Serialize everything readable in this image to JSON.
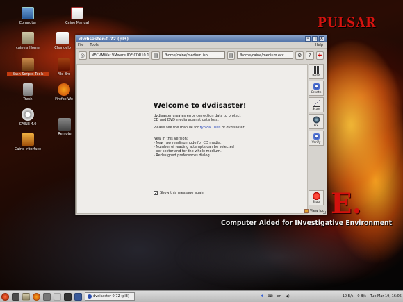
{
  "desktop": {
    "icons": [
      {
        "label": "Computer"
      },
      {
        "label": "Caine Manual"
      },
      {
        "label": "caine's Home"
      },
      {
        "label": "Changelo"
      },
      {
        "label": "Bash Scripts Tools"
      },
      {
        "label": "File Bro"
      },
      {
        "label": "Trash"
      },
      {
        "label": "Firefox We"
      },
      {
        "label": "CAINE 4.0"
      },
      {
        "label": "Remote"
      },
      {
        "label": "Caine Interface"
      }
    ],
    "brand": {
      "title": "PULSAR",
      "letter": "E.",
      "tagline": "Computer Aided for INvestigative Environment"
    },
    "colors": {
      "brand_red": "#d6130f",
      "selection": "#c33b10"
    }
  },
  "window": {
    "title": "dvdisaster-0.72 (pl3)",
    "menu": {
      "file": "File",
      "tools": "Tools",
      "help": "Help"
    },
    "toolbar": {
      "drive": "NECVMWar VMware IDE CDR10 1.0",
      "image_file": "/home/caine/medium.iso",
      "ecc_file": "/home/caine/medium.ecc"
    },
    "welcome": {
      "title": "Welcome to dvdisaster!",
      "para1_line1": "dvdisaster creates error correction data to protect",
      "para1_line2": "CD and DVD media against data loss.",
      "para2_prefix": "Please see the manual for ",
      "para2_link": "typical uses",
      "para2_suffix": " of dvdisaster.",
      "news_heading": "New in this Version:",
      "news": [
        "- New raw reading mode for CD media.",
        "- Number of reading attempts can be selected",
        "  per sector and for the whole medium.",
        "- Redesigned preferences dialog."
      ],
      "checkbox_label": "Show this message again",
      "checkbox_checked": true
    },
    "sidebar": {
      "read": "Read",
      "create": "Create",
      "scan": "Scan",
      "fix": "Fix",
      "verify": "Verify",
      "stop": "Stop"
    },
    "view_log": "View log"
  },
  "taskbar": {
    "task_label": "dvdisaster-0.72 (pl3)",
    "lang": "en",
    "network": "10 B/s",
    "network2": "0 B/s",
    "clock": "Tue Mar 19, 16:05"
  }
}
